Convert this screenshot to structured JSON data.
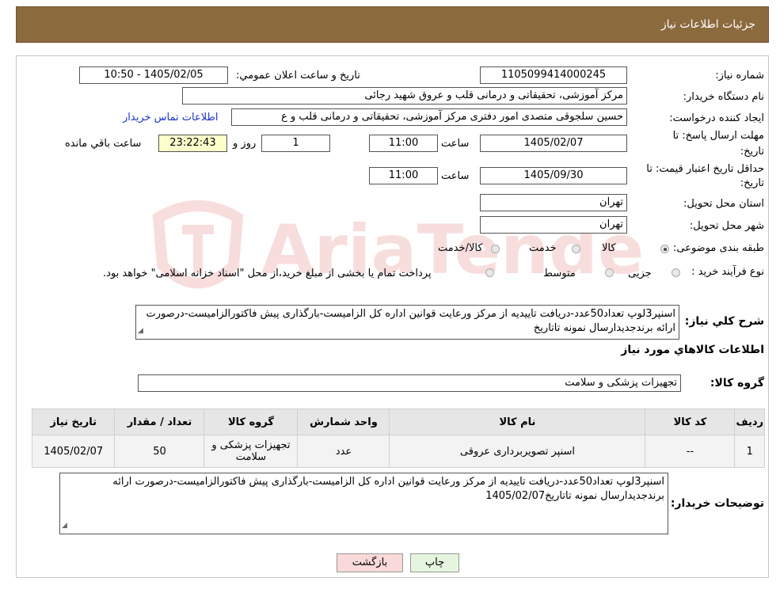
{
  "header": {
    "title": "جزئیات اطلاعات نیاز"
  },
  "watermark": {
    "text": "AriaTender.neT"
  },
  "labels": {
    "need_number": "شماره نیاز:",
    "announce_datetime": "تاریخ و ساعت اعلان عمومي:",
    "buyer_org": "نام دستگاه خریدار:",
    "requester": "ایجاد کننده درخواست:",
    "contact_link": "اطلاعات تماس خریدار",
    "deadline_send_1": "مهلت ارسال پاسخ: تا",
    "deadline_send_2": "تاریخ:",
    "time_word": "ساعت",
    "days_word": "روز و",
    "remaining_word": "ساعت باقي مانده",
    "price_valid_1": "حداقل تاریخ اعتبار قیمت: تا",
    "price_valid_2": "تاریخ:",
    "province": "استان محل تحویل:",
    "city": "شهر محل تحویل:",
    "category": "طبقه بندی موضوعی:",
    "purchase_type": "نوع فرآیند خرید :",
    "description": "شرح كلي نياز:",
    "goods_info": "اطلاعات كالاهاي مورد نياز",
    "goods_group": "گروه كالا:",
    "buyer_notes": "توضیحات خریدار:"
  },
  "fields": {
    "need_number": "1105099414000245",
    "announce_datetime": "1405/02/05 - 10:50",
    "buyer_org": "مرکز آموزشی، تحقیقاتی و درمانی قلب و عروق شهید رجائی",
    "requester": "حسین سلجوقی متصدی امور دفتری مرکز آموزشی، تحقیقاتی و درمانی قلب و ع",
    "deadline_date": "1405/02/07",
    "deadline_time": "11:00",
    "deadline_days": "1",
    "deadline_remaining": "23:22:43",
    "price_valid_date": "1405/09/30",
    "price_valid_time": "11:00",
    "province": "تهران",
    "city": "تهران",
    "goods_group": "تجهیزات پزشکی و سلامت"
  },
  "category_options": [
    "کالا",
    "خدمت",
    "کالا/خدمت"
  ],
  "category_selected": "کالا",
  "purchase_options": [
    "جزیی",
    "متوسط"
  ],
  "purchase_note": "پرداخت تمام یا بخشی از مبلغ خرید،از محل \"اسناد خزانه اسلامی\" خواهد بود.",
  "description_text": "اسنپر3لوپ تعداد50عدد-دریافت تاییدیه از مرکز ورعایت قوانین اداره کل الزامیست-بارگذاری پیش فاکتورالزامیست-درصورت ارائه برندجدیدارسال نمونه تاتاریخ",
  "table": {
    "headers": [
      "ردیف",
      "کد کالا",
      "نام کالا",
      "واحد شمارش",
      "گروه کالا",
      "تعداد / مقدار",
      "تاریخ نیاز"
    ],
    "rows": [
      [
        "1",
        "--",
        "اسنپر تصویربرداری عروقی",
        "عدد",
        "تجهیزات پزشکی و سلامت",
        "50",
        "1405/02/07"
      ]
    ]
  },
  "buyer_notes_text": "اسنپر3لوپ تعداد50عدد-دریافت تاییدیه از مرکز ورعایت قوانین اداره کل الزامیست-بارگذاری پیش فاکتورالزامیست-درصورت ارائه برندجدیدارسال نمونه تاتاریخ1405/02/07",
  "buttons": {
    "print": "چاپ",
    "back": "بازگشت"
  },
  "colors": {
    "header": "#8b6a3e",
    "yellow": "#ffffcc",
    "link": "#1a33cc"
  }
}
